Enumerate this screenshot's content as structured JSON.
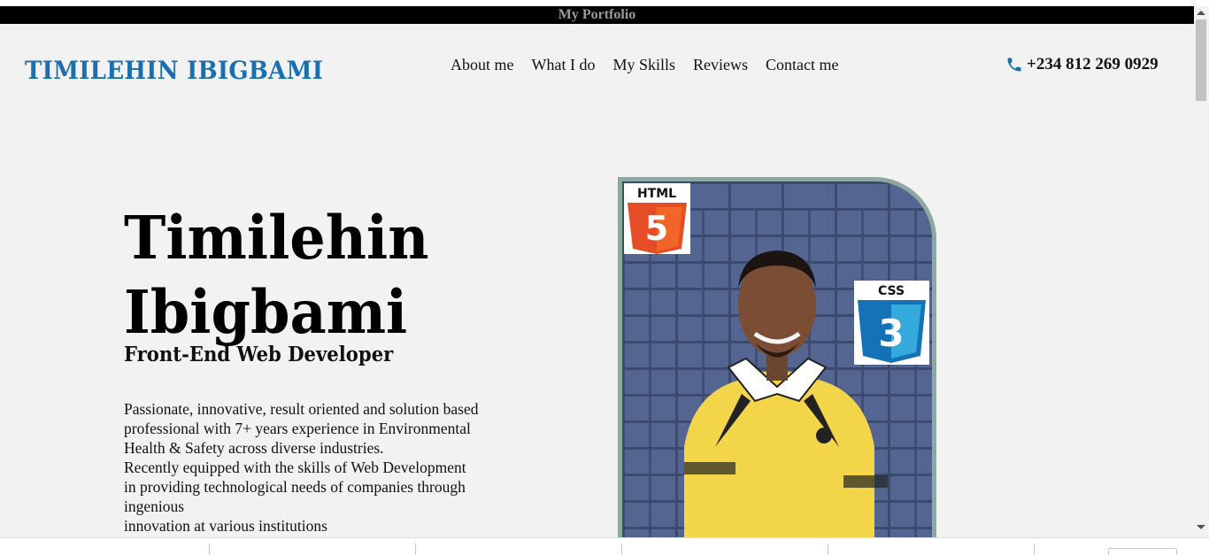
{
  "window": {
    "title": "My Portfolio"
  },
  "header": {
    "brand": "TIMILEHIN IBIGBAMI",
    "nav": [
      "About me",
      "What I do",
      "My Skills",
      "Reviews",
      "Contact me"
    ],
    "phone": "+234 812 269 0929"
  },
  "hero": {
    "name_line1": "Timilehin",
    "name_line2": "Ibigbami",
    "role": "Front-End Web Developer",
    "bio_lines": [
      "Passionate, innovative, result oriented and solution based",
      "professional with 7+ years experience in Environmental",
      "Health & Safety across diverse industries.",
      "Recently equipped with the skills of Web Development",
      "in providing technological needs of companies through",
      "ingenious",
      "innovation at various institutions"
    ],
    "badges": {
      "html": "HTML",
      "html_num": "5",
      "css": "CSS",
      "css_num": "3"
    }
  },
  "colors": {
    "brand": "#1a6fb0",
    "page_bg": "#f2f2f2",
    "title_bar": "#000000",
    "frame": "#8fa7a2",
    "html_orange": "#e44d26",
    "css_blue": "#1572b6"
  },
  "icons": {
    "phone": "phone-icon"
  }
}
